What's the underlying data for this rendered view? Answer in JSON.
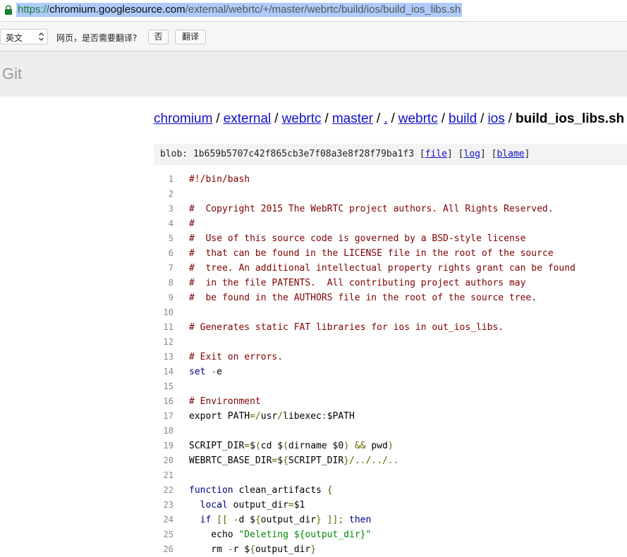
{
  "address_bar": {
    "url_scheme": "https://",
    "url_host": "chromium.googlesource.com",
    "url_path": "/external/webrtc/+/master/webrtc/build/ios/build_ios_libs.sh"
  },
  "translate_bar": {
    "language": "英文",
    "question": "网页，是否需要翻译?",
    "no_label": "否",
    "translate_label": "翻译"
  },
  "header": {
    "title": "Git"
  },
  "breadcrumb": {
    "items": [
      "chromium",
      "external",
      "webrtc",
      "master",
      ".",
      "webrtc",
      "build",
      "ios"
    ],
    "separator": "/",
    "current": "build_ios_libs.sh"
  },
  "blob": {
    "prefix": "blob:",
    "hash": "1b659b5707c42f865cb3e7f08a3e8f28f79ba1f3",
    "links": [
      "file",
      "log",
      "blame"
    ]
  },
  "code": [
    {
      "n": "1",
      "tokens": [
        {
          "t": "#!/bin/bash",
          "c": "com"
        }
      ]
    },
    {
      "n": "2",
      "tokens": []
    },
    {
      "n": "3",
      "tokens": [
        {
          "t": "#  Copyright 2015 The WebRTC project authors. All Rights Reserved.",
          "c": "com"
        }
      ]
    },
    {
      "n": "4",
      "tokens": [
        {
          "t": "#",
          "c": "com"
        }
      ]
    },
    {
      "n": "5",
      "tokens": [
        {
          "t": "#  Use of this source code is governed by a BSD-style license",
          "c": "com"
        }
      ]
    },
    {
      "n": "6",
      "tokens": [
        {
          "t": "#  that can be found in the LICENSE file in the root of the source",
          "c": "com"
        }
      ]
    },
    {
      "n": "7",
      "tokens": [
        {
          "t": "#  tree. An additional intellectual property rights grant can be found",
          "c": "com"
        }
      ]
    },
    {
      "n": "8",
      "tokens": [
        {
          "t": "#  in the file PATENTS.  All contributing project authors may",
          "c": "com"
        }
      ]
    },
    {
      "n": "9",
      "tokens": [
        {
          "t": "#  be found in the AUTHORS file in the root of the source tree.",
          "c": "com"
        }
      ]
    },
    {
      "n": "10",
      "tokens": []
    },
    {
      "n": "11",
      "tokens": [
        {
          "t": "# Generates static FAT libraries for ios in out_ios_libs.",
          "c": "com"
        }
      ]
    },
    {
      "n": "12",
      "tokens": []
    },
    {
      "n": "13",
      "tokens": [
        {
          "t": "# Exit on errors.",
          "c": "com"
        }
      ]
    },
    {
      "n": "14",
      "tokens": [
        {
          "t": "set",
          "c": "kw"
        },
        {
          "t": " "
        },
        {
          "t": "-",
          "c": "op"
        },
        {
          "t": "e"
        }
      ]
    },
    {
      "n": "15",
      "tokens": []
    },
    {
      "n": "16",
      "tokens": [
        {
          "t": "# Environment",
          "c": "com"
        }
      ]
    },
    {
      "n": "17",
      "tokens": [
        {
          "t": "export PATH"
        },
        {
          "t": "=/",
          "c": "op"
        },
        {
          "t": "usr"
        },
        {
          "t": "/",
          "c": "op"
        },
        {
          "t": "libexec"
        },
        {
          "t": ":",
          "c": "op"
        },
        {
          "t": "$PATH"
        }
      ]
    },
    {
      "n": "18",
      "tokens": []
    },
    {
      "n": "19",
      "tokens": [
        {
          "t": "SCRIPT_DIR"
        },
        {
          "t": "=",
          "c": "op"
        },
        {
          "t": "$"
        },
        {
          "t": "(",
          "c": "op"
        },
        {
          "t": "cd $"
        },
        {
          "t": "(",
          "c": "op"
        },
        {
          "t": "dirname $0"
        },
        {
          "t": ")",
          "c": "op"
        },
        {
          "t": " "
        },
        {
          "t": "&&",
          "c": "op"
        },
        {
          "t": " pwd"
        },
        {
          "t": ")",
          "c": "op"
        }
      ]
    },
    {
      "n": "20",
      "tokens": [
        {
          "t": "WEBRTC_BASE_DIR"
        },
        {
          "t": "=",
          "c": "op"
        },
        {
          "t": "$"
        },
        {
          "t": "{",
          "c": "op"
        },
        {
          "t": "SCRIPT_DIR"
        },
        {
          "t": "}/../../..",
          "c": "op"
        }
      ]
    },
    {
      "n": "21",
      "tokens": []
    },
    {
      "n": "22",
      "tokens": [
        {
          "t": "function",
          "c": "kw"
        },
        {
          "t": " clean_artifacts "
        },
        {
          "t": "{",
          "c": "op"
        }
      ]
    },
    {
      "n": "23",
      "tokens": [
        {
          "t": "  "
        },
        {
          "t": "local",
          "c": "kw"
        },
        {
          "t": " output_dir"
        },
        {
          "t": "=",
          "c": "op"
        },
        {
          "t": "$1"
        }
      ]
    },
    {
      "n": "24",
      "tokens": [
        {
          "t": "  "
        },
        {
          "t": "if",
          "c": "kw"
        },
        {
          "t": " "
        },
        {
          "t": "[[",
          "c": "op"
        },
        {
          "t": " "
        },
        {
          "t": "-",
          "c": "op"
        },
        {
          "t": "d $"
        },
        {
          "t": "{",
          "c": "op"
        },
        {
          "t": "output_dir"
        },
        {
          "t": "}",
          "c": "op"
        },
        {
          "t": " "
        },
        {
          "t": "]];",
          "c": "op"
        },
        {
          "t": " "
        },
        {
          "t": "then",
          "c": "kw"
        }
      ]
    },
    {
      "n": "25",
      "tokens": [
        {
          "t": "    echo "
        },
        {
          "t": "\"Deleting ${output_dir}\"",
          "c": "str"
        }
      ]
    },
    {
      "n": "26",
      "tokens": [
        {
          "t": "    rm "
        },
        {
          "t": "-",
          "c": "op"
        },
        {
          "t": "r $"
        },
        {
          "t": "{",
          "c": "op"
        },
        {
          "t": "output_dir"
        },
        {
          "t": "}",
          "c": "op"
        }
      ]
    }
  ]
}
